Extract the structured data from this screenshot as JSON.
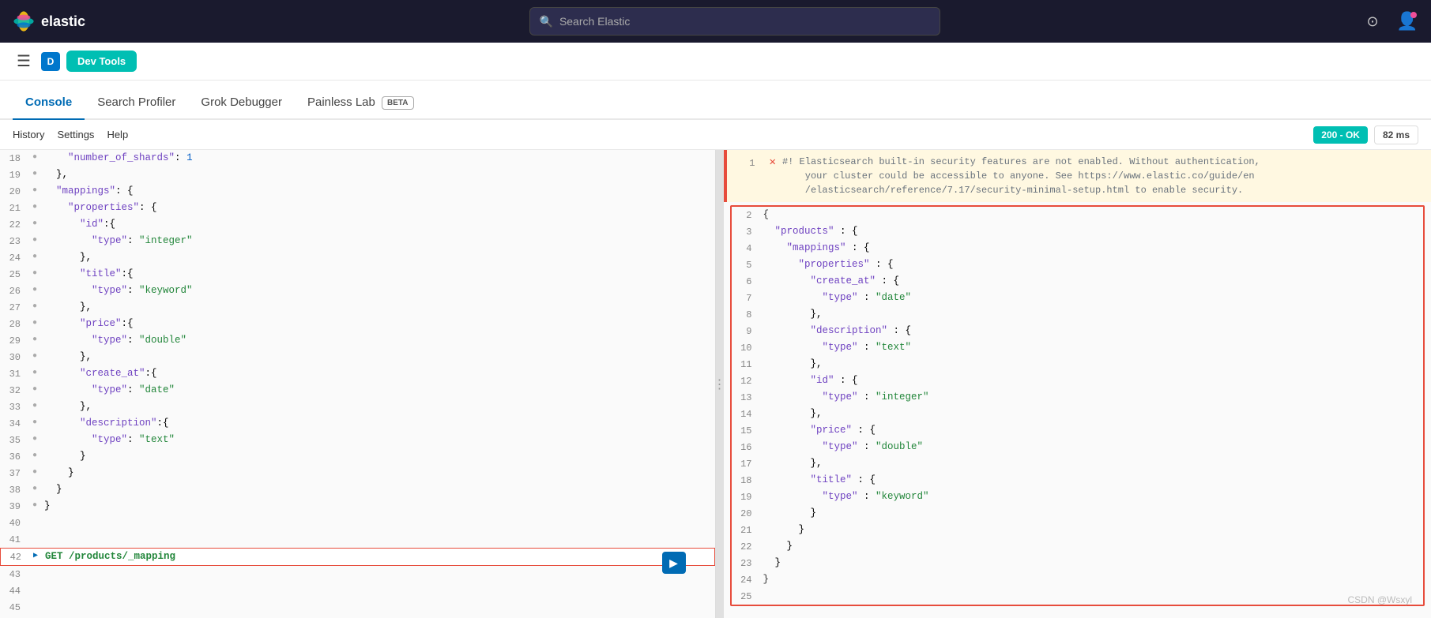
{
  "topnav": {
    "logo_text": "elastic",
    "search_placeholder": "Search Elastic",
    "notification_icon": "🔔",
    "user_icon": "👤"
  },
  "secondarynav": {
    "devtools_label": "Dev Tools",
    "avatar_letter": "D"
  },
  "tabs": [
    {
      "id": "console",
      "label": "Console",
      "active": true
    },
    {
      "id": "search-profiler",
      "label": "Search Profiler",
      "active": false
    },
    {
      "id": "grok-debugger",
      "label": "Grok Debugger",
      "active": false
    },
    {
      "id": "painless-lab",
      "label": "Painless Lab",
      "active": false
    }
  ],
  "beta_label": "BETA",
  "toolbar": {
    "history_label": "History",
    "settings_label": "Settings",
    "help_label": "Help",
    "status_label": "200 - OK",
    "timing_label": "82 ms"
  },
  "editor": {
    "lines": [
      {
        "num": 18,
        "gutter": "*",
        "content": "    \"number_of_shards\": 1"
      },
      {
        "num": 19,
        "gutter": "*",
        "content": "  },"
      },
      {
        "num": 20,
        "gutter": "*",
        "content": "  \"mappings\": {"
      },
      {
        "num": 21,
        "gutter": "*",
        "content": "    \"properties\": {"
      },
      {
        "num": 22,
        "gutter": "*",
        "content": "      \"id\":{"
      },
      {
        "num": 23,
        "gutter": "*",
        "content": "        \"type\":\"integer\""
      },
      {
        "num": 24,
        "gutter": "*",
        "content": "      },"
      },
      {
        "num": 25,
        "gutter": "*",
        "content": "      \"title\":{"
      },
      {
        "num": 26,
        "gutter": "*",
        "content": "        \"type\":\"keyword\""
      },
      {
        "num": 27,
        "gutter": "*",
        "content": "      },"
      },
      {
        "num": 28,
        "gutter": "*",
        "content": "      \"price\":{"
      },
      {
        "num": 29,
        "gutter": "*",
        "content": "        \"type\":\"double\""
      },
      {
        "num": 30,
        "gutter": "*",
        "content": "      },"
      },
      {
        "num": 31,
        "gutter": "*",
        "content": "      \"create_at\":{"
      },
      {
        "num": 32,
        "gutter": "*",
        "content": "        \"type\":\"date\""
      },
      {
        "num": 33,
        "gutter": "*",
        "content": "      },"
      },
      {
        "num": 34,
        "gutter": "*",
        "content": "      \"description\":{"
      },
      {
        "num": 35,
        "gutter": "*",
        "content": "        \"type\":\"text\""
      },
      {
        "num": 36,
        "gutter": "*",
        "content": "      }"
      },
      {
        "num": 37,
        "gutter": "*",
        "content": "    }"
      },
      {
        "num": 38,
        "gutter": "*",
        "content": "  }"
      },
      {
        "num": 39,
        "gutter": "*",
        "content": "}"
      },
      {
        "num": 40,
        "gutter": "",
        "content": ""
      },
      {
        "num": 41,
        "gutter": "",
        "content": ""
      },
      {
        "num": 42,
        "gutter": "▶",
        "content": "GET /products/_mapping",
        "active": true
      },
      {
        "num": 43,
        "gutter": "",
        "content": ""
      },
      {
        "num": 44,
        "gutter": "",
        "content": ""
      },
      {
        "num": 45,
        "gutter": "",
        "content": ""
      }
    ]
  },
  "output": {
    "warning": "#! Elasticsearch built-in security features are not enabled. Without authentication, your cluster could be accessible to anyone. See https://www.elastic.co/guide/en/elasticsearch/reference/7.17/security-minimal-setup.html to enable security.",
    "lines": [
      {
        "num": 1,
        "type": "comment",
        "content": "#! Elasticsearch built-in security features are not enabled. Without authentication,"
      },
      {
        "num": "",
        "type": "comment-cont",
        "content": "    your cluster could be accessible to anyone. See https://www.elastic.co/guide/en"
      },
      {
        "num": "",
        "type": "comment-cont",
        "content": "    /elasticsearch/reference/7.17/security-minimal-setup.html to enable security."
      },
      {
        "num": 2,
        "type": "brace",
        "content": "{"
      },
      {
        "num": 3,
        "type": "json",
        "content": "  \"products\" : {"
      },
      {
        "num": 4,
        "type": "json",
        "content": "    \"mappings\" : {"
      },
      {
        "num": 5,
        "type": "json",
        "content": "      \"properties\" : {"
      },
      {
        "num": 6,
        "type": "json",
        "content": "        \"create_at\" : {"
      },
      {
        "num": 7,
        "type": "json",
        "content": "          \"type\" : \"date\""
      },
      {
        "num": 8,
        "type": "json",
        "content": "        },"
      },
      {
        "num": 9,
        "type": "json",
        "content": "        \"description\" : {"
      },
      {
        "num": 10,
        "type": "json",
        "content": "          \"type\" : \"text\""
      },
      {
        "num": 11,
        "type": "json",
        "content": "        },"
      },
      {
        "num": 12,
        "type": "json",
        "content": "        \"id\" : {"
      },
      {
        "num": 13,
        "type": "json",
        "content": "          \"type\" : \"integer\""
      },
      {
        "num": 14,
        "type": "json",
        "content": "        },"
      },
      {
        "num": 15,
        "type": "json",
        "content": "        \"price\" : {"
      },
      {
        "num": 16,
        "type": "json",
        "content": "          \"type\" : \"double\""
      },
      {
        "num": 17,
        "type": "json",
        "content": "        },"
      },
      {
        "num": 18,
        "type": "json",
        "content": "        \"title\" : {"
      },
      {
        "num": 19,
        "type": "json",
        "content": "          \"type\" : \"keyword\""
      },
      {
        "num": 20,
        "type": "json",
        "content": "        }"
      },
      {
        "num": 21,
        "type": "json",
        "content": "      }"
      },
      {
        "num": 22,
        "type": "json",
        "content": "    }"
      },
      {
        "num": 23,
        "type": "json",
        "content": "  }"
      },
      {
        "num": 24,
        "type": "brace",
        "content": "}"
      },
      {
        "num": 25,
        "type": "empty",
        "content": ""
      }
    ]
  },
  "watermark": "CSDN @Wsxyl"
}
